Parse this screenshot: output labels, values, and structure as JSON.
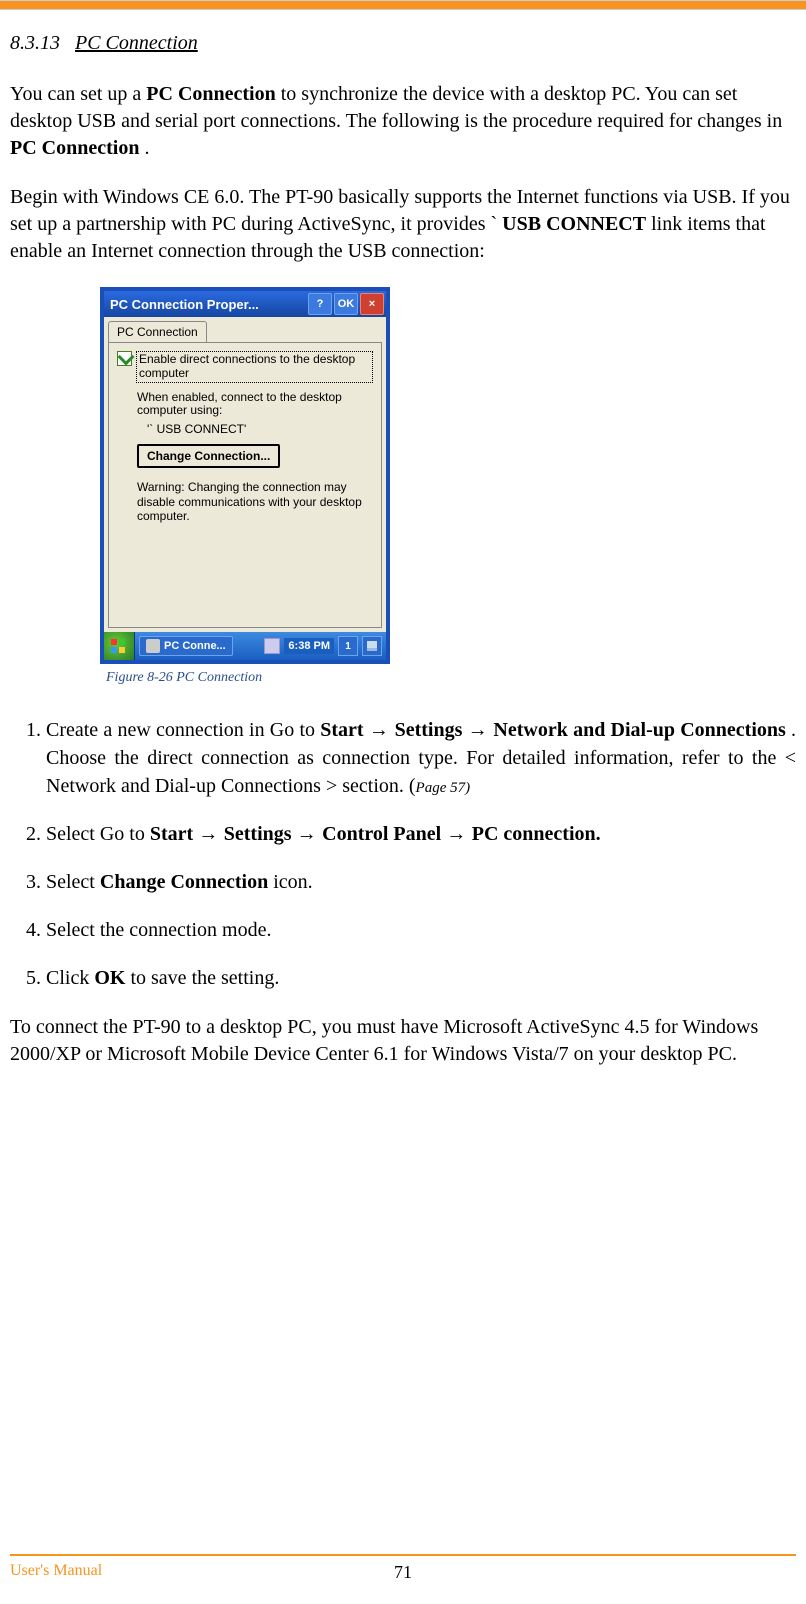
{
  "heading": {
    "number": "8.3.13",
    "title": "PC Connection"
  },
  "para1": {
    "pre": "You can set up a ",
    "b1": "PC Connection",
    "mid": " to synchronize the device with a desktop PC. You can set desktop USB and serial port connections. The following is the procedure required for changes in ",
    "b2": "PC Connection",
    "end": "."
  },
  "para2": {
    "pre": "Begin with Windows CE 6.0. The PT-90 basically supports the Internet functions via USB. If you set up a partnership with PC during ActiveSync, it provides `",
    "b1": "USB CONNECT",
    "end": " link items that enable an Internet connection through the USB connection:"
  },
  "dialog": {
    "title": "PC Connection Proper...",
    "help_label": "?",
    "ok_label": "OK",
    "close_label": "×",
    "tab_label": "PC Connection",
    "checkbox_label": "Enable direct connections to the desktop computer",
    "when_enabled": "When enabled, connect to the desktop computer using:",
    "conn_value": "'` USB CONNECT'",
    "change_btn": "Change Connection...",
    "warning": "Warning: Changing the connection may disable communications with your desktop computer.",
    "task_item": "PC Conne...",
    "clock": "6:38 PM",
    "tray_kb": "1"
  },
  "caption": "Figure 8-26 PC Connection",
  "steps": {
    "s1": {
      "pre": "Create a new connection in Go to ",
      "b1": "Start",
      "arr1": " → ",
      "b2": "Settings",
      "arr2": " → ",
      "b3": "Network and Dial-up Connections",
      "mid": ". Choose the direct connection as connection type. For detailed information, refer to the < Network and Dial-up Connections > section. (",
      "pref": "Page 57)",
      "end": ""
    },
    "s2": {
      "pre": "Select Go to ",
      "b1": "Start ",
      "arr1": " → ",
      "b2": "Settings ",
      "arr2": " → ",
      "b3": "Control Panel ",
      "arr3": " → ",
      "b4": "PC connection."
    },
    "s3": {
      "pre": "Select ",
      "b1": "Change Connection",
      "end": " icon."
    },
    "s4": {
      "text": "Select the connection mode."
    },
    "s5": {
      "pre": "Click ",
      "b1": "OK",
      "end": " to save the setting."
    }
  },
  "para3": "To connect the PT-90 to a desktop PC, you must have Microsoft ActiveSync 4.5 for Windows 2000/XP or Microsoft Mobile Device Center 6.1 for Windows Vista/7 on your desktop PC.",
  "footer": {
    "left": "User's Manual",
    "page": "71"
  }
}
